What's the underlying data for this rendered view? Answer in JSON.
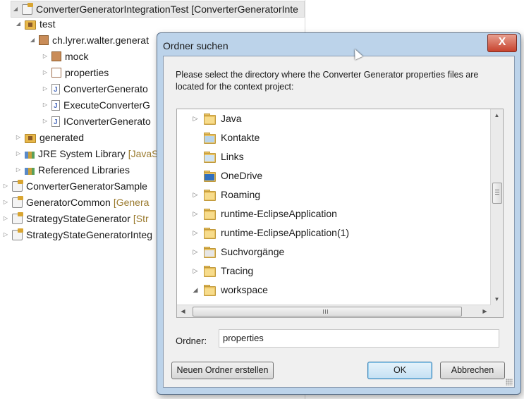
{
  "explorer": {
    "rows": [
      {
        "label": "ConverterGeneratorIntegrationTest [ConverterGeneratorInte",
        "deco": ""
      },
      {
        "label": "test",
        "deco": ""
      },
      {
        "label": "ch.lyrer.walter.generat",
        "deco": ""
      },
      {
        "label": "mock",
        "deco": ""
      },
      {
        "label": "properties",
        "deco": ""
      },
      {
        "label": "ConverterGenerato",
        "deco": ""
      },
      {
        "label": "ExecuteConverterG",
        "deco": ""
      },
      {
        "label": "IConverterGenerato",
        "deco": ""
      },
      {
        "label": "generated",
        "deco": ""
      },
      {
        "label": "JRE System Library",
        "deco": "[JavaS"
      },
      {
        "label": "Referenced Libraries",
        "deco": ""
      },
      {
        "label": "ConverterGeneratorSample",
        "deco": ""
      },
      {
        "label": "GeneratorCommon",
        "deco": "[Genera"
      },
      {
        "label": "StrategyStateGenerator",
        "deco": "[Str"
      },
      {
        "label": "StrategyStateGeneratorInteg",
        "deco": ""
      }
    ]
  },
  "dialog": {
    "title": "Ordner suchen",
    "close_label": "X",
    "instruction": "Please select the directory where the Converter Generator properties files are located for the context project:",
    "folders": [
      {
        "label": "Java",
        "arrow": "▷"
      },
      {
        "label": "Kontakte",
        "arrow": ""
      },
      {
        "label": "Links",
        "arrow": ""
      },
      {
        "label": "OneDrive",
        "arrow": ""
      },
      {
        "label": "Roaming",
        "arrow": "▷"
      },
      {
        "label": "runtime-EclipseApplication",
        "arrow": "▷"
      },
      {
        "label": "runtime-EclipseApplication(1)",
        "arrow": "▷"
      },
      {
        "label": "Suchvorgänge",
        "arrow": "▷"
      },
      {
        "label": "Tracing",
        "arrow": "▷"
      },
      {
        "label": "workspace",
        "arrow": "◢"
      }
    ],
    "folder_label": "Ordner:",
    "folder_value": "properties",
    "new_folder_button": "Neuen Ordner erstellen",
    "ok_button": "OK",
    "cancel_button": "Abbrechen"
  }
}
